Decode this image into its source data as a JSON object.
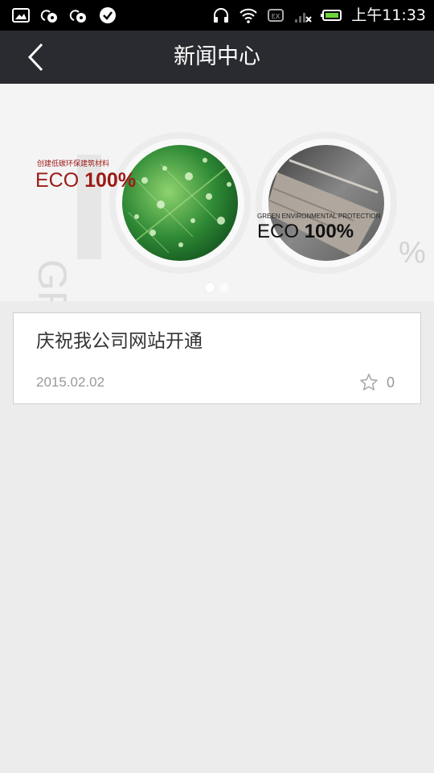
{
  "status_bar": {
    "time": "上午11:33",
    "icons_left": [
      "image-icon",
      "cloud-sync-icon",
      "cloud-sync-icon",
      "check-circle-icon"
    ],
    "icons_right": [
      "headset-icon",
      "wifi-icon",
      "ex-badge-icon",
      "signal-icon",
      "battery-icon"
    ]
  },
  "nav": {
    "title": "新闻中心",
    "back_icon": "chevron-left-icon"
  },
  "banner": {
    "bg_text": "GREEN",
    "left_caption": "创建低碳环保建筑材料",
    "left_eco": "ECO 100%",
    "right_caption": "GREEN ENVIRONMENTAL PROTECTION",
    "right_eco": "ECO 100%",
    "percent_symbol": "%",
    "colors": {
      "red": "#9b1b17",
      "leaf": "#2f8a35",
      "stone": "#6b6b6b"
    },
    "dots": 2,
    "active_dot": 0
  },
  "news": [
    {
      "title": "庆祝我公司网站开通",
      "date": "2015.02.02",
      "likes": "0"
    }
  ]
}
